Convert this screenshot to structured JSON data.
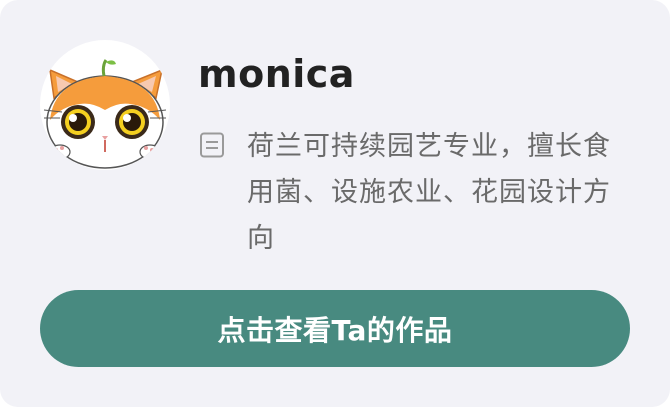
{
  "profile": {
    "username": "monica",
    "avatar_icon": "cartoon-cat-avatar",
    "bio_icon": "document-icon",
    "bio": "荷兰可持续园艺专业，擅长食用菌、设施农业、花园设计方向"
  },
  "actions": {
    "view_works_label": "点击查看Ta的作品"
  },
  "colors": {
    "card_background": "#f2f2f7",
    "button_background": "#488a80",
    "button_text": "#ffffff",
    "username_text": "#222222",
    "bio_text": "#6a6a6a"
  }
}
